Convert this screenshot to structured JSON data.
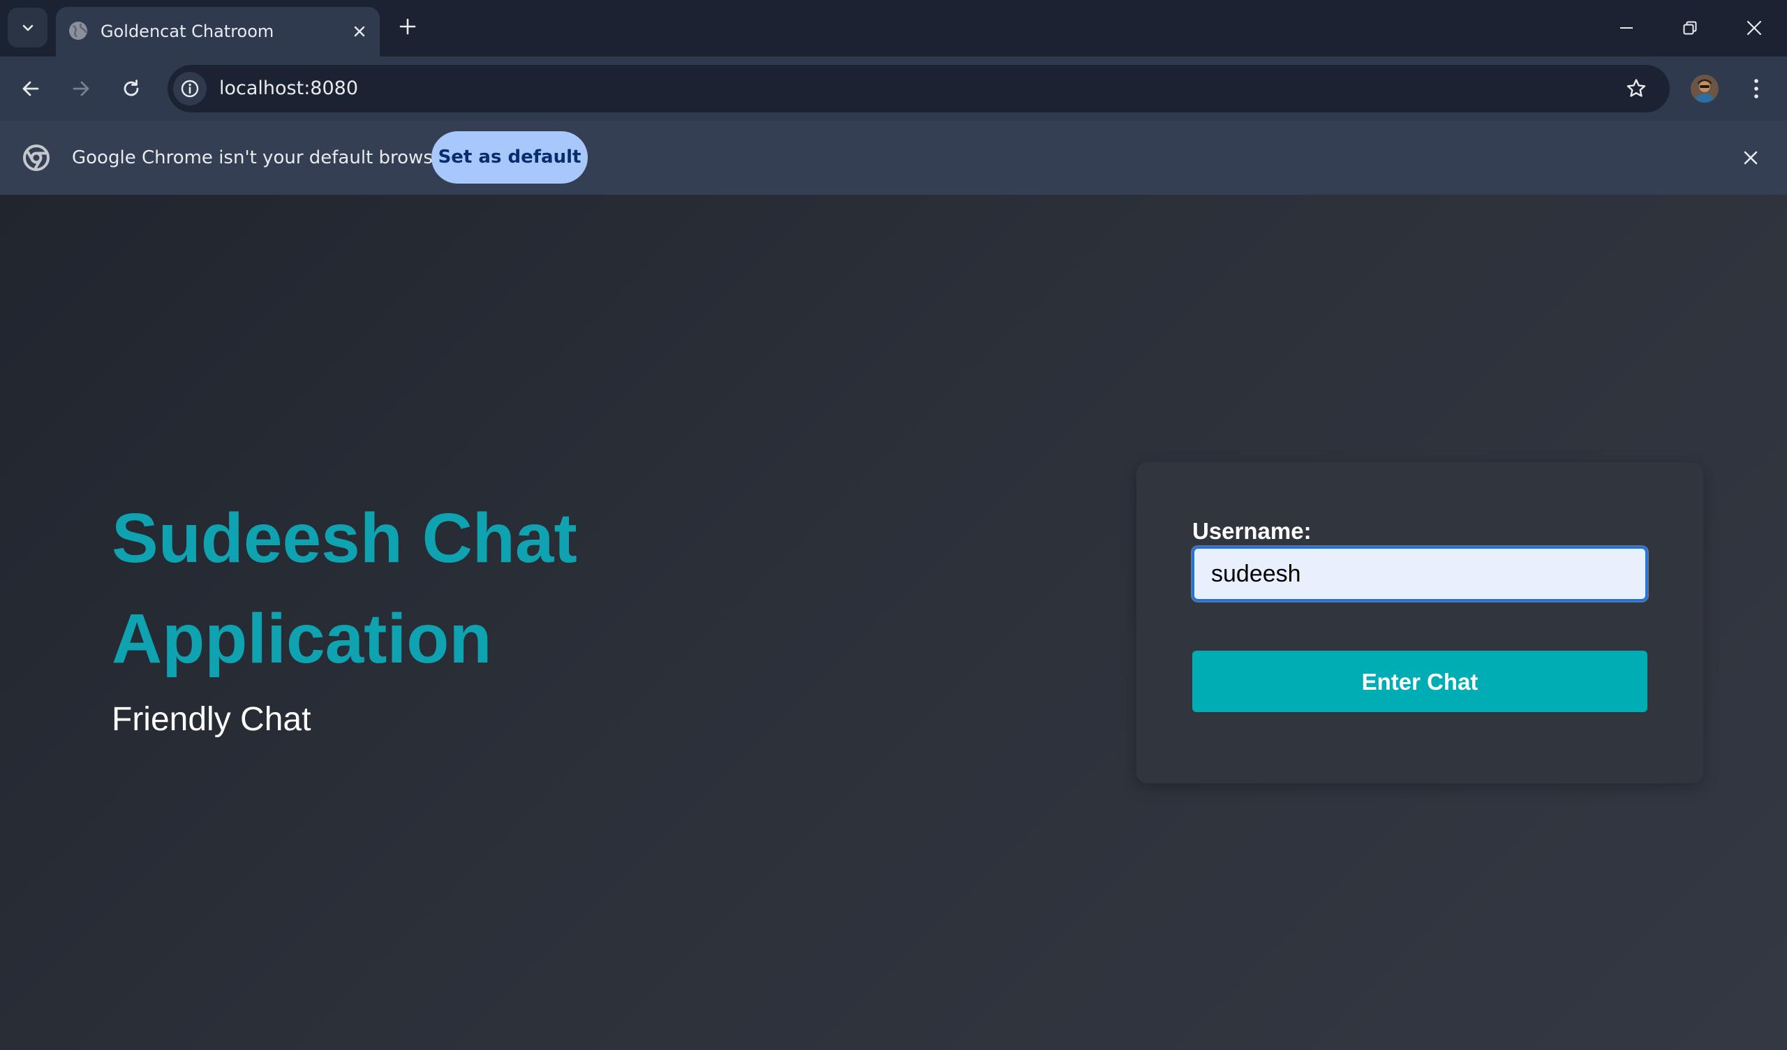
{
  "browser": {
    "tab": {
      "title": "Goldencat Chatroom",
      "favicon": "globe-icon"
    },
    "address_bar": {
      "url": "localhost:8080"
    },
    "infobar": {
      "message": "Google Chrome isn't your default browser",
      "button_label": "Set as default"
    },
    "colors": {
      "tabstrip": "#1b2333",
      "toolbar": "#2f3a4f",
      "infobar_button": "#a8c7fa"
    }
  },
  "page": {
    "hero": {
      "title": "Sudeesh Chat Application",
      "subtitle": "Friendly Chat"
    },
    "login": {
      "username_label": "Username:",
      "username_value": "sudeesh",
      "submit_label": "Enter Chat"
    },
    "colors": {
      "accent": "#0fa3b1",
      "button": "#00adb5",
      "card": "#30353e"
    }
  }
}
